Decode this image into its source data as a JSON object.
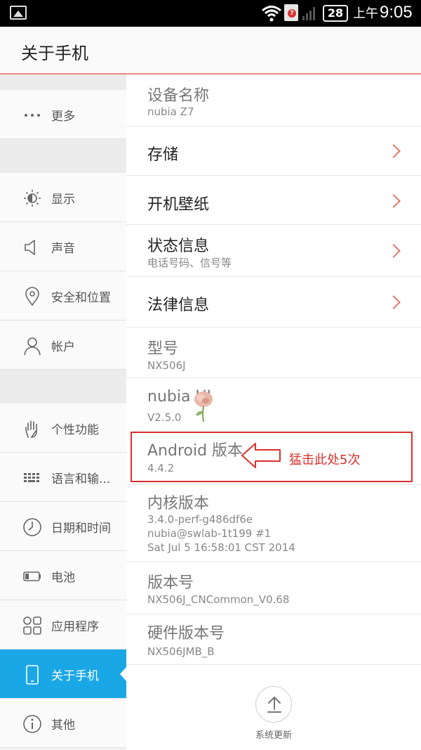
{
  "status_bar": {
    "sim_badge": "?",
    "battery_level": "28",
    "time_prefix": "上午",
    "time": "9:05"
  },
  "header": {
    "title": "关于手机"
  },
  "sidebar": {
    "items": [
      {
        "label": "更多",
        "icon": "more-dots-icon"
      },
      {
        "label": "显示",
        "icon": "brightness-icon"
      },
      {
        "label": "声音",
        "icon": "speaker-icon"
      },
      {
        "label": "安全和位置",
        "icon": "location-pin-icon"
      },
      {
        "label": "帐户",
        "icon": "person-icon"
      },
      {
        "label": "个性功能",
        "icon": "hand-icon"
      },
      {
        "label": "语言和输...",
        "icon": "keyboard-icon"
      },
      {
        "label": "日期和时间",
        "icon": "clock-icon"
      },
      {
        "label": "电池",
        "icon": "battery-icon"
      },
      {
        "label": "应用程序",
        "icon": "apps-grid-icon"
      },
      {
        "label": "关于手机",
        "icon": "phone-icon",
        "active": true
      },
      {
        "label": "其他",
        "icon": "info-icon"
      }
    ]
  },
  "about": {
    "device_name": {
      "title": "设备名称",
      "value": "nubia Z7"
    },
    "storage": {
      "title": "存储"
    },
    "wallpaper": {
      "title": "开机壁纸"
    },
    "status": {
      "title": "状态信息",
      "subtitle": "电话号码、信号等"
    },
    "legal": {
      "title": "法律信息"
    },
    "model": {
      "title": "型号",
      "value": "NX506J"
    },
    "nubia_ui": {
      "title": "nubia UI",
      "value": "V2.5.0"
    },
    "android_version": {
      "title": "Android 版本",
      "value": "4.4.2"
    },
    "kernel": {
      "title": "内核版本",
      "line1": "3.4.0-perf-g486df6e",
      "line2": "nubia@swlab-1t199 #1",
      "line3": "Sat Jul 5 16:58:01 CST 2014"
    },
    "build": {
      "title": "版本号",
      "value": "NX506J_CNCommon_V0.68"
    },
    "hardware": {
      "title": "硬件版本号",
      "value": "NX506JMB_B"
    }
  },
  "annotation": {
    "text": "猛击此处5次",
    "color": "#d9312b"
  },
  "system_update": {
    "label": "系统更新"
  },
  "colors": {
    "accent": "#1aa7e6",
    "chevron": "#e2766a",
    "header_rule": "#e88a80"
  }
}
